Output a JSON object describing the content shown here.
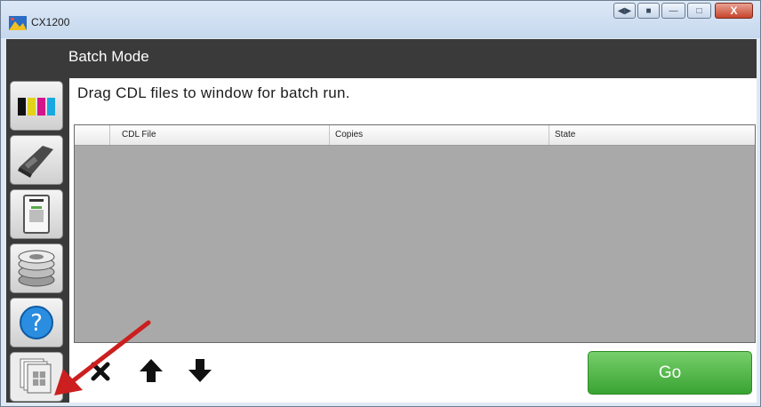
{
  "window": {
    "title": "CX1200"
  },
  "header": {
    "title": "Batch Mode"
  },
  "main": {
    "instruction": "Drag CDL files to window for batch run.",
    "table": {
      "columns": [
        "CDL File",
        "Copies",
        "State"
      ],
      "rows": []
    }
  },
  "toolbar": {
    "go_label": "Go"
  },
  "sidebar": {
    "items": [
      {
        "icon": "color-bars-icon"
      },
      {
        "icon": "printhead-icon"
      },
      {
        "icon": "printer-icon"
      },
      {
        "icon": "media-rolls-icon"
      },
      {
        "icon": "help-icon"
      },
      {
        "icon": "batch-mode-icon",
        "active": true
      }
    ]
  },
  "colors": {
    "accent_green": "#3da336",
    "header_bg": "#3a3a3a",
    "table_bg": "#a9a9a9",
    "arrow_red": "#cc1f1f"
  }
}
